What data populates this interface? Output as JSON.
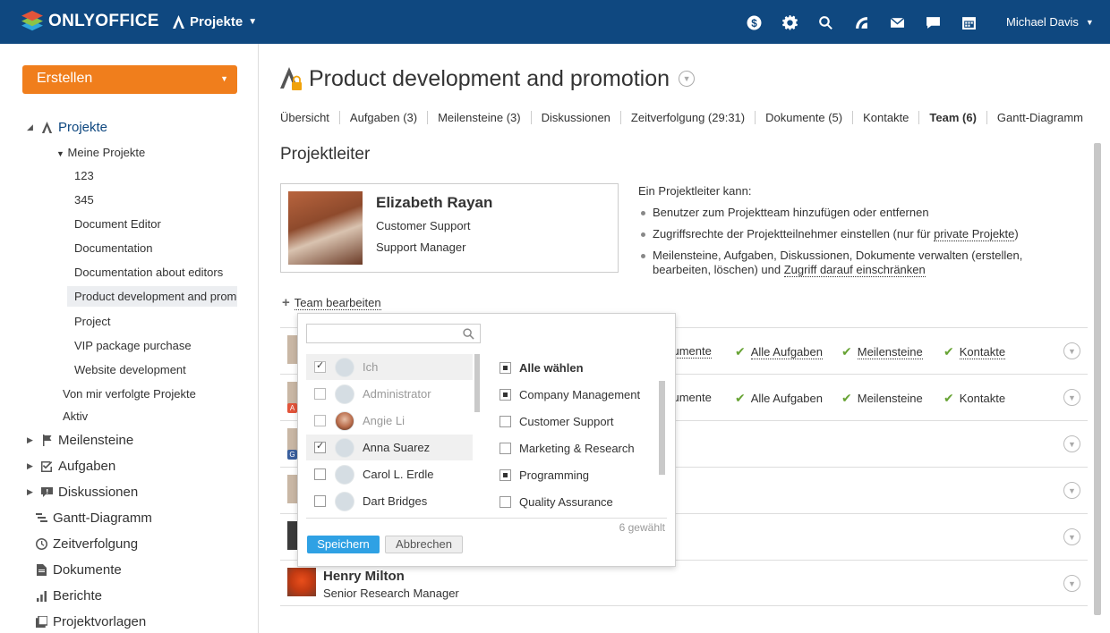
{
  "topbar": {
    "logo_text": "ONLYOFFICE",
    "module": "Projekte",
    "icons": [
      "currency-icon",
      "gear-icon",
      "search-icon",
      "feed-icon",
      "mail-icon",
      "chat-icon",
      "calendar-icon"
    ],
    "user": "Michael Davis",
    "bg_color": "#0f4880"
  },
  "sidebar": {
    "create_label": "Erstellen",
    "create_color": "#f07e1c",
    "projects_label": "Projekte",
    "my_projects_label": "Meine Projekte",
    "my_projects": [
      "123",
      "345",
      "Document Editor",
      "Documentation",
      "Documentation about editors",
      "Product development and promotion",
      "Project",
      "VIP package purchase",
      "Website development"
    ],
    "followed_label": "Von mir verfolgte Projekte",
    "active_label": "Aktiv",
    "sections": [
      "Meilensteine",
      "Aufgaben",
      "Diskussionen",
      "Gantt-Diagramm",
      "Zeitverfolgung",
      "Dokumente",
      "Berichte",
      "Projektvorlagen"
    ]
  },
  "main": {
    "title": "Product development and promotion",
    "tabs": [
      "Übersicht",
      "Aufgaben (3)",
      "Meilensteine (3)",
      "Diskussionen",
      "Zeitverfolgung (29:31)",
      "Dokumente (5)",
      "Kontakte",
      "Team (6)",
      "Gantt-Diagramm"
    ],
    "active_tab": "Team (6)",
    "section_title": "Projektleiter",
    "manager": {
      "name": "Elizabeth Rayan",
      "department": "Customer Support",
      "position": "Support Manager"
    },
    "rights": {
      "intro": "Ein Projektleiter kann:",
      "item1": "Benutzer zum Projektteam hinzufügen oder entfernen",
      "item2_pre": "Zugriffsrechte der Projektteilnehmer einstellen (nur für ",
      "item2_link": "private Projekte",
      "item2_post": ")",
      "item3_pre": "Meilensteine, Aufgaben, Diskussionen, Dokumente verwalten (erstellen, bearbeiten, löschen) und ",
      "item3_link": "Zugriff darauf einschränken"
    },
    "edit_team_label": "Team bearbeiten",
    "perm_labels": {
      "documents_partial": "kumente",
      "all_tasks": "Alle Aufgaben",
      "milestones": "Meilensteine",
      "contacts": "Kontakte"
    },
    "badges": [
      "A",
      "G"
    ],
    "last_member": {
      "name": "Henry Milton",
      "position": "Senior Research Manager"
    }
  },
  "popup": {
    "search_placeholder": "",
    "users": [
      {
        "name": "Ich",
        "checked": true,
        "disabled": true
      },
      {
        "name": "Administrator",
        "checked": false,
        "disabled": true
      },
      {
        "name": "Angie Li",
        "checked": false,
        "disabled": true
      },
      {
        "name": "Anna Suarez",
        "checked": true,
        "disabled": false
      },
      {
        "name": "Carol L. Erdle",
        "checked": false,
        "disabled": false
      },
      {
        "name": "Dart Bridges",
        "checked": false,
        "disabled": false
      }
    ],
    "groups": [
      {
        "name": "Alle wählen",
        "state": "partial"
      },
      {
        "name": "Company Management",
        "state": "partial"
      },
      {
        "name": "Customer Support",
        "state": "none"
      },
      {
        "name": "Marketing & Research",
        "state": "none"
      },
      {
        "name": "Programming",
        "state": "partial"
      },
      {
        "name": "Quality Assurance",
        "state": "none"
      }
    ],
    "selected_count": "6 gewählt",
    "save_label": "Speichern",
    "cancel_label": "Abbrechen",
    "save_color": "#2fa1e4"
  }
}
